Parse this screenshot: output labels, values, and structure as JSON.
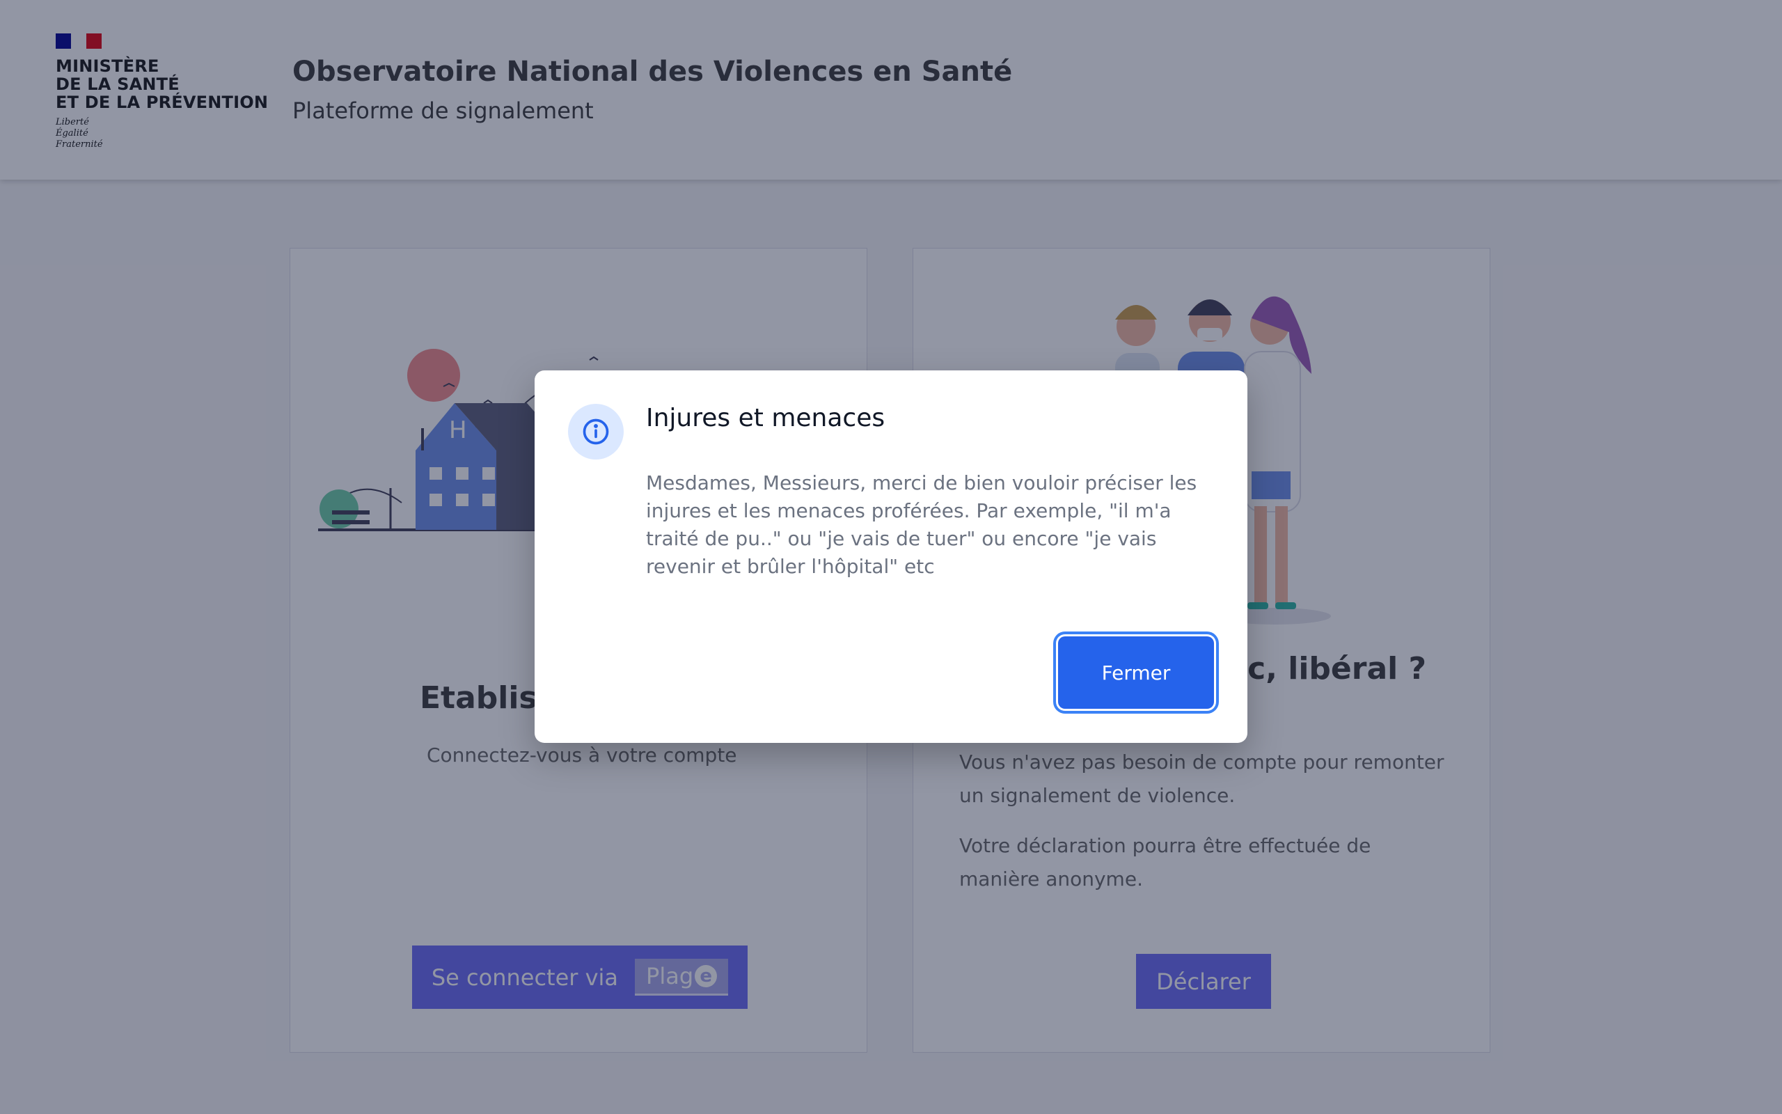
{
  "header": {
    "ministry_lines": [
      "MINISTÈRE",
      "DE LA SANTÉ",
      "ET DE LA PRÉVENTION"
    ],
    "motto_lines": [
      "Liberté",
      "Égalité",
      "Fraternité"
    ],
    "title": "Observatoire National des Violences en Santé",
    "tagline": "Plateforme de signalement"
  },
  "cards": {
    "left": {
      "title": "Etablissement de santé",
      "text": "Connectez-vous à votre compte",
      "button_label": "Se connecter via",
      "button_brand": "Plag",
      "button_brand_suffix": "e"
    },
    "right": {
      "title": "Grand public, libéral ?",
      "text1": "Vous n'avez pas besoin de compte pour remonter un signalement de violence.",
      "text2": "Votre déclaration pourra être effectuée de manière anonyme.",
      "button_label": "Déclarer"
    }
  },
  "modal": {
    "icon": "info-icon",
    "title": "Injures et menaces",
    "body": "Mesdames, Messieurs, merci de bien vouloir préciser les injures et les menaces proférées. Par exemple, \"il m'a traité de pu..\" ou \"je vais de tuer\" ou encore \"je vais revenir et brûler l'hôpital\" etc",
    "close_label": "Fermer"
  },
  "colors": {
    "accent": "#2563eb",
    "card_button": "#6a6af4",
    "overlay": "rgba(24,32,62,0.47)",
    "flag_blue": "#000091",
    "flag_red": "#e1000f"
  }
}
